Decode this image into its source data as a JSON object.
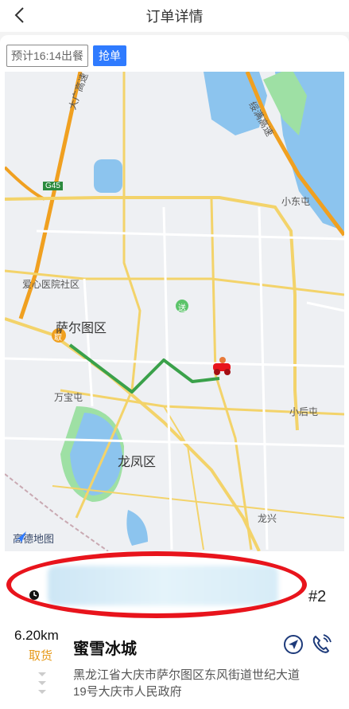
{
  "header": {
    "title": "订单详情",
    "back_icon": "chevron-left-icon"
  },
  "tags": {
    "estimate": "预计16:14出餐",
    "grab": "抢单"
  },
  "map": {
    "labels": {
      "expressway1": "大广高速",
      "g45": "G45",
      "expressway2": "绥满高速",
      "xiaodongtun": "小东屯",
      "hospital": "爱心医院社区",
      "saertu": "萨尔图区",
      "wanbaotun": "万宝屯",
      "xiaohoutun": "小后屯",
      "longfeng": "龙凤区",
      "longxing": "龙兴",
      "pickup_marker": "取",
      "delivery_marker": "送"
    },
    "logo_text": "高德地图",
    "colors": {
      "route": "#3aa14a",
      "road_yellow": "#f3d36a",
      "road_orange": "#f0a020",
      "water": "#8cc4ee",
      "park": "#9ee0a4"
    }
  },
  "order": {
    "number": "#2",
    "distance": "6.20km",
    "pickup_label": "取货",
    "shop_name": "蜜雪冰城",
    "address": "黑龙江省大庆市萨尔图区东风街道世纪大道19号大庆市人民政府",
    "accent_color": "#e69a1b"
  }
}
